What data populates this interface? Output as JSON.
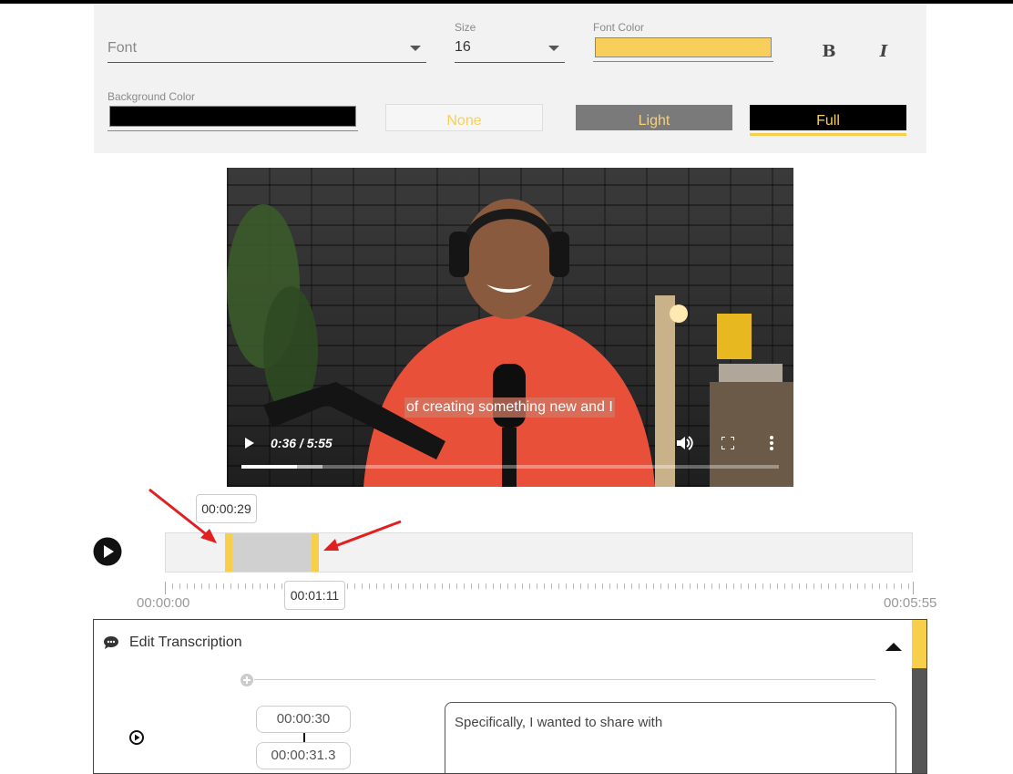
{
  "style_panel": {
    "font": {
      "placeholder": "Font"
    },
    "size": {
      "label": "Size",
      "value": "16"
    },
    "font_color": {
      "label": "Font Color",
      "value": "#f7cf5a"
    },
    "background_color": {
      "label": "Background Color",
      "value": "#000000"
    },
    "bold_label": "B",
    "italic_label": "I",
    "background_options": [
      {
        "label": "None",
        "selected": false
      },
      {
        "label": "Light",
        "selected": false
      },
      {
        "label": "Full",
        "selected": true
      }
    ]
  },
  "video": {
    "subtitle": "of creating something new and I",
    "time": "0:36 / 5:55",
    "progress_fraction": 0.103,
    "buffered_fraction": 0.15
  },
  "timeline": {
    "start_tooltip": "00:00:29",
    "end_tooltip": "00:01:11",
    "start_label": "00:00:00",
    "end_label": "00:05:55",
    "duration_seconds": 355,
    "selection_start_seconds": 29,
    "selection_end_seconds": 71
  },
  "edit_transcription": {
    "title": "Edit Transcription",
    "segment": {
      "start": "00:00:30",
      "end": "00:00:31.3",
      "text": "Specifically, I wanted to share with"
    }
  },
  "colors": {
    "accent": "#f7cf4b",
    "annotation_arrow": "#e02020"
  }
}
